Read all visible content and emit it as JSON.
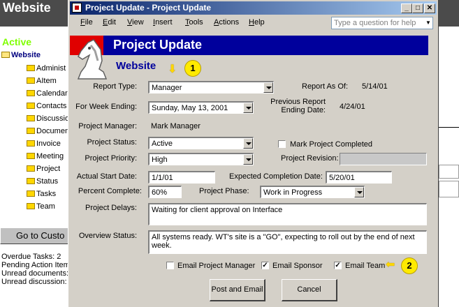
{
  "background_app": {
    "title": "Website",
    "status": "Active",
    "tree_root": "Website",
    "tree_items": [
      "Administ",
      "AItem",
      "Calendar",
      "Contacts",
      "Discussio",
      "Documen",
      "Invoice",
      "Meeting",
      "Project",
      "Status",
      "Tasks",
      "Team"
    ],
    "goto_button": "Go to Custo",
    "stats": [
      "Overdue Tasks: 2",
      "Pending Action Item",
      "Unread documents:",
      "Unread discussion: "
    ]
  },
  "window": {
    "title": "Project Update - Project Update",
    "menu": [
      "File",
      "Edit",
      "View",
      "Insert",
      "Tools",
      "Actions",
      "Help"
    ],
    "help_placeholder": "Type a question for help"
  },
  "form": {
    "banner_title": "Project Update",
    "website_title": "Website",
    "callouts": [
      "1",
      "2"
    ],
    "report_type": {
      "label": "Report Type:",
      "value": "Manager"
    },
    "report_as_of": {
      "label": "Report As Of:",
      "value": "5/14/01"
    },
    "week_ending": {
      "label": "For Week Ending:",
      "value": "Sunday, May 13, 2001"
    },
    "previous_report": {
      "label_line1": "Previous Report",
      "label_line2": "Ending Date:",
      "value": "4/24/01"
    },
    "project_manager": {
      "label": "Project Manager:",
      "value": "Mark Manager"
    },
    "project_status": {
      "label": "Project Status:",
      "value": "Active"
    },
    "mark_completed": {
      "label": "Mark Project Completed",
      "checked": false
    },
    "project_priority": {
      "label": "Project Priority:",
      "value": "High"
    },
    "project_revision": {
      "label": "Project Revision:",
      "value": ""
    },
    "actual_start": {
      "label": "Actual Start Date:",
      "value": "1/1/01"
    },
    "expected_completion": {
      "label": "Expected Completion Date:",
      "value": "5/20/01"
    },
    "percent_complete": {
      "label": "Percent Complete:",
      "value": "60%"
    },
    "project_phase": {
      "label": "Project Phase:",
      "value": "Work in Progress"
    },
    "project_delays": {
      "label": "Project Delays:",
      "value": "Waiting for client approval on Interface"
    },
    "overview_status": {
      "label": "Overview Status:",
      "value": "All systems ready.  WT's site is a \"GO\", expecting to roll out by the end of next week."
    },
    "email_pm": {
      "label": "Email Project Manager",
      "checked": false
    },
    "email_sponsor": {
      "label": "Email Sponsor",
      "checked": true
    },
    "email_team": {
      "label": "Email Team",
      "checked": true
    },
    "post_button": "Post and Email",
    "cancel_button": "Cancel"
  },
  "colors": {
    "banner": "#00009c",
    "accent_red": "#e00000",
    "callout": "#ffea00",
    "dialog": "#d4d0c8"
  }
}
